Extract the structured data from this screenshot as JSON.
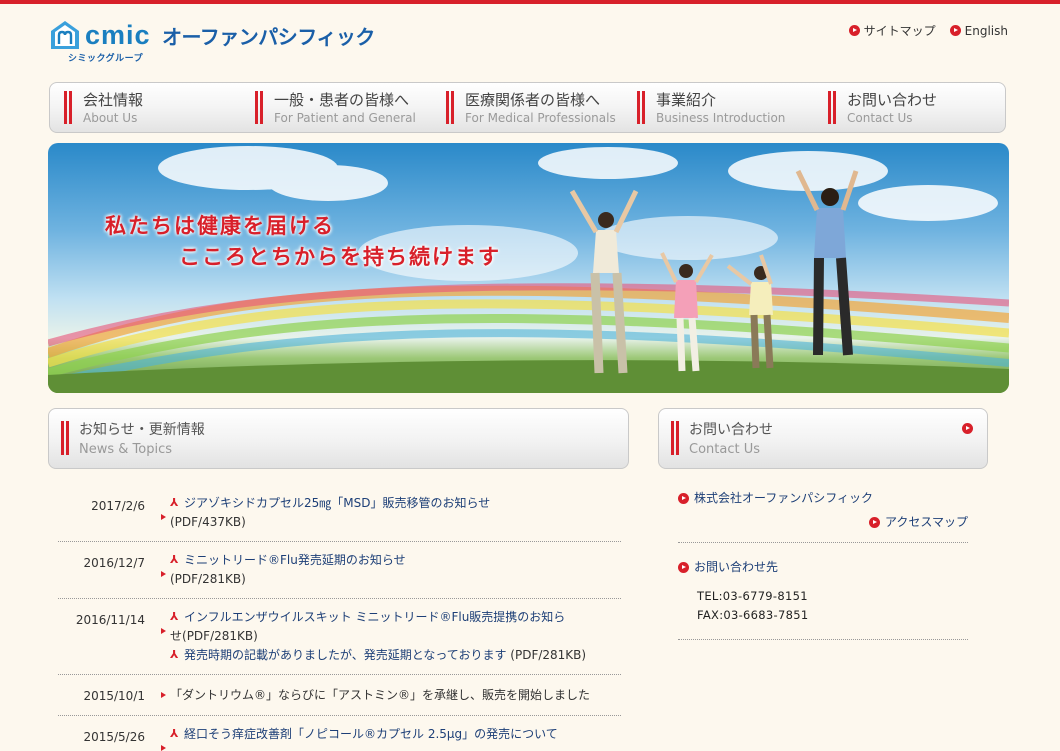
{
  "header": {
    "logo_mark": "cmic",
    "logo_name": "オーファンパシフィック",
    "logo_sub": "シミックグループ",
    "util_links": [
      {
        "label": "サイトマップ",
        "icon": "red-arrow-circle-icon"
      },
      {
        "label": "English",
        "icon": "red-arrow-circle-icon"
      }
    ]
  },
  "nav": {
    "items": [
      {
        "jp": "会社情報",
        "en": "About Us"
      },
      {
        "jp": "一般・患者の皆様へ",
        "en": "For Patient and General"
      },
      {
        "jp": "医療関係者の皆様へ",
        "en": "For Medical Professionals"
      },
      {
        "jp": "事業紹介",
        "en": "Business Introduction"
      },
      {
        "jp": "お問い合わせ",
        "en": "Contact Us"
      }
    ]
  },
  "hero": {
    "line1": "私たちは健康を届ける",
    "line2": "こころとちからを持ち続けます"
  },
  "news": {
    "title_jp": "お知らせ・更新情報",
    "title_en": "News & Topics",
    "items": [
      {
        "date": "2017/2/6",
        "pdf": true,
        "title": "ジアゾキシドカプセル25㎎「MSD」販売移管のお知らせ",
        "suffix": "(PDF/437KB)"
      },
      {
        "date": "2016/12/7",
        "pdf": true,
        "title": "ミニットリード®Flu発売延期のお知らせ",
        "suffix": "(PDF/281KB)"
      },
      {
        "date": "2016/11/14",
        "pdf": true,
        "title": "インフルエンザウイルスキット ミニットリード®Flu販売提携のお知ら",
        "title_cont": "せ",
        "suffix": "(PDF/281KB)",
        "extra_pdf": true,
        "extra": "発売時期の記載がありましたが、発売延期となっております",
        "extra_suffix": "(PDF/281KB)"
      },
      {
        "date": "2015/10/1",
        "pdf": false,
        "title": "「ダントリウム®」ならびに「アストミン®」を承継し、販売を開始しました"
      },
      {
        "date": "2015/5/26",
        "pdf": true,
        "title": "経口そう痒症改善剤「ノピコール®カプセル 2.5μg」の発売について"
      }
    ]
  },
  "contact": {
    "title_jp": "お問い合わせ",
    "title_en": "Contact Us",
    "company": "株式会社オーファンパシフィック",
    "access": "アクセスマップ",
    "inquiry": "お問い合わせ先",
    "tel": "TEL:03-6779-8151",
    "fax": "FAX:03-6683-7851"
  },
  "colors": {
    "accent_red": "#d8202a",
    "brand_blue": "#1a7fc0",
    "link_navy": "#1d3f77",
    "background": "#fdf8ee"
  }
}
